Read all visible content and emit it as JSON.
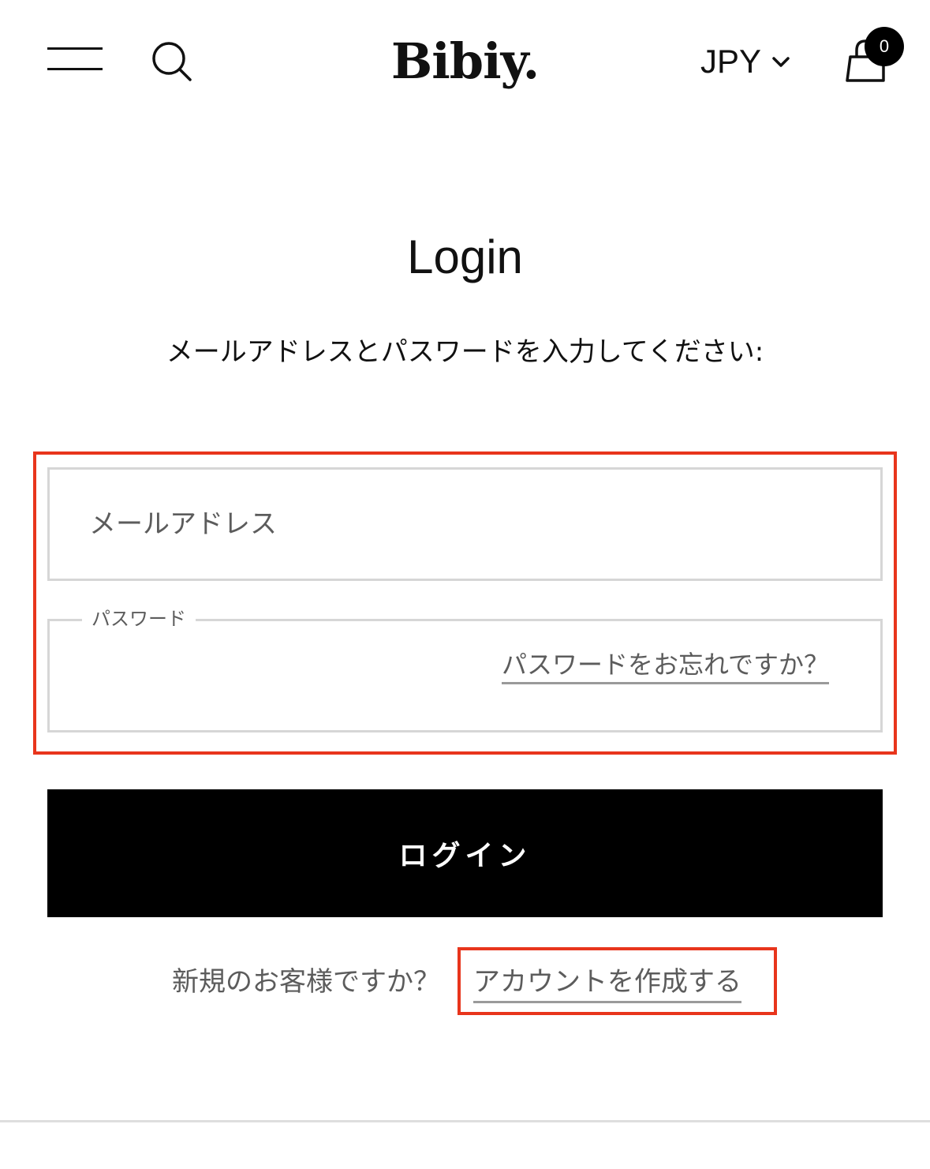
{
  "header": {
    "logo_text": "Bibiy.",
    "currency": "JPY",
    "cart_count": "0",
    "icons": {
      "menu": "hamburger-menu-icon",
      "search": "search-icon",
      "currency_dropdown": "chevron-down-icon",
      "cart": "shopping-bag-icon"
    }
  },
  "main": {
    "title": "Login",
    "subtitle": "メールアドレスとパスワードを入力してください:",
    "email": {
      "placeholder": "メールアドレス",
      "value": ""
    },
    "password": {
      "label": "パスワード",
      "value": "",
      "forgot_link": "パスワードをお忘れですか？"
    },
    "login_button": "ログイン",
    "register": {
      "prompt": "新規のお客様ですか？",
      "link": "アカウントを作成する"
    }
  },
  "colors": {
    "highlight": "#e8351c",
    "button_bg": "#000000",
    "border": "#d6d6d6",
    "muted_text": "#5c5c5c"
  }
}
